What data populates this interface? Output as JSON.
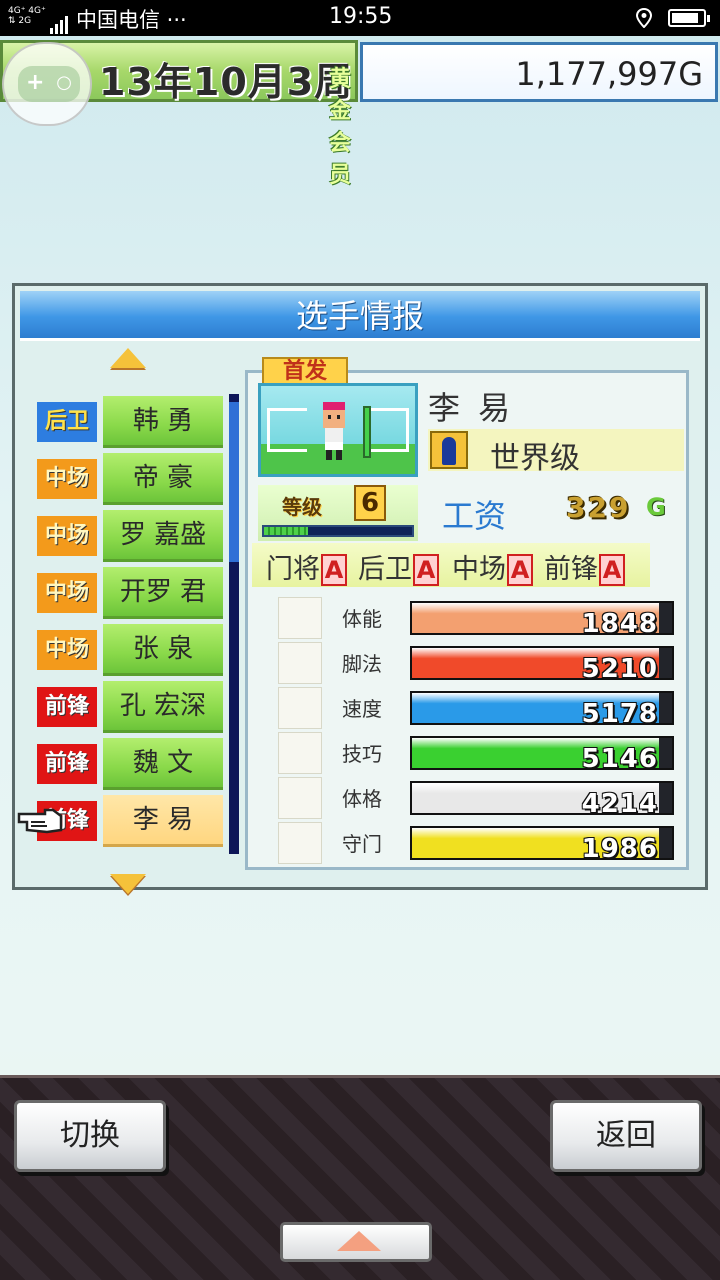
{
  "status_bar": {
    "network": "4G+ 4G+ 2G",
    "carrier": "中国电信 ···",
    "time": "19:55"
  },
  "header": {
    "date": "13年10月3周",
    "membership": "黄金会员",
    "money": "1,177,997G"
  },
  "dialog": {
    "title": "选手情报"
  },
  "players": [
    {
      "position": "后卫",
      "pos_type": "df",
      "name": "韩 勇",
      "selected": false
    },
    {
      "position": "中场",
      "pos_type": "mf",
      "name": "帝 豪",
      "selected": false
    },
    {
      "position": "中场",
      "pos_type": "mf",
      "name": "罗 嘉盛",
      "selected": false
    },
    {
      "position": "中场",
      "pos_type": "mf",
      "name": "开罗 君",
      "selected": false
    },
    {
      "position": "中场",
      "pos_type": "mf",
      "name": "张 泉",
      "selected": false
    },
    {
      "position": "前锋",
      "pos_type": "fw",
      "name": "孔 宏深",
      "selected": false
    },
    {
      "position": "前锋",
      "pos_type": "fw",
      "name": "魏 文",
      "selected": false
    },
    {
      "position": "前锋",
      "pos_type": "fw",
      "name": "李 易",
      "selected": true
    }
  ],
  "detail": {
    "badge": "首发",
    "name": "李 易",
    "rank": "世界级",
    "level_label": "等级",
    "level": "6",
    "level_progress": 0.3,
    "salary_label": "工资",
    "salary": "329",
    "salary_unit": "G",
    "aptitudes": [
      {
        "label": "门将",
        "grade": "A"
      },
      {
        "label": "后卫",
        "grade": "A"
      },
      {
        "label": "中场",
        "grade": "A"
      },
      {
        "label": "前锋",
        "grade": "A"
      }
    ],
    "stats": [
      {
        "label": "体能",
        "value": "1848",
        "icon": "battery-icon",
        "color": "#f3a070",
        "fill": 0.95
      },
      {
        "label": "脚法",
        "value": "5210",
        "icon": "boot-icon",
        "color": "#f04a2a",
        "fill": 0.95
      },
      {
        "label": "速度",
        "value": "5178",
        "icon": "running-icon",
        "color": "#2a9ae8",
        "fill": 0.95
      },
      {
        "label": "技巧",
        "value": "5146",
        "icon": "dribble-icon",
        "color": "#3ad030",
        "fill": 0.95
      },
      {
        "label": "体格",
        "value": "4214",
        "icon": "muscle-icon",
        "color": "#e8e8e8",
        "fill": 0.95
      },
      {
        "label": "守门",
        "value": "1986",
        "icon": "glove-icon",
        "color": "#f0e020",
        "fill": 0.95
      }
    ]
  },
  "buttons": {
    "switch": "切换",
    "back": "返回"
  }
}
